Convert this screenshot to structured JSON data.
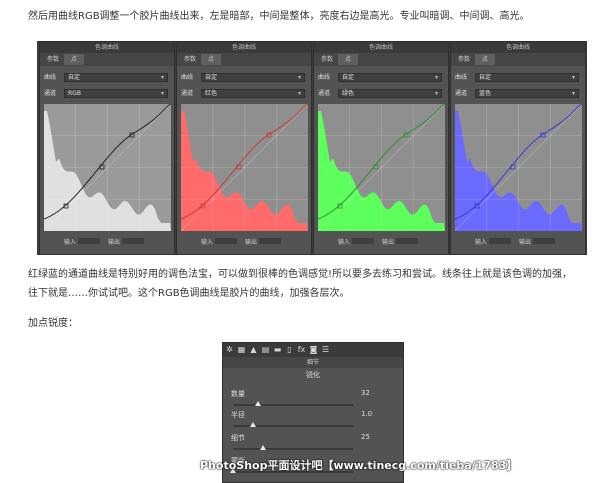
{
  "text": {
    "intro": "然后用曲线RGB调整一个胶片曲线出来，左是暗部，中间是整体，亮度右边是高光。专业叫暗调、中间调、高光。",
    "explain_line1": "红绿蓝的通道曲线是特别好用的调色法宝，可以做到很棒的色调感觉!所以要多去练习和尝试。线条往上就是该色调的加强，",
    "explain_line2": "往下就是……你试试吧。这个RGB色调曲线是胶片的曲线，加强各层次。",
    "sharpen_heading": "加点锐度："
  },
  "curves_panels": [
    {
      "title": "色调曲线",
      "tab_params": "参数",
      "tab_point": "点",
      "curve_label": "曲线",
      "curve_value": "自定",
      "channel_label": "通道",
      "channel_value": "RGB",
      "input_label": "输入",
      "output_label": "输出",
      "channel_color": "#222222",
      "hist_color": "#e0e0e0"
    },
    {
      "title": "色调曲线",
      "tab_params": "参数",
      "tab_point": "点",
      "curve_label": "曲线",
      "curve_value": "自定",
      "channel_label": "通道",
      "channel_value": "红色",
      "input_label": "输入",
      "output_label": "输出",
      "channel_color": "#c83a3a",
      "hist_color": "#ff6a6a"
    },
    {
      "title": "色调曲线",
      "tab_params": "参数",
      "tab_point": "点",
      "curve_label": "曲线",
      "curve_value": "自定",
      "channel_label": "通道",
      "channel_value": "绿色",
      "input_label": "输入",
      "output_label": "输出",
      "channel_color": "#2f8f2f",
      "hist_color": "#5cff5c"
    },
    {
      "title": "色调曲线",
      "tab_params": "参数",
      "tab_point": "点",
      "curve_label": "曲线",
      "curve_value": "自定",
      "channel_label": "通道",
      "channel_value": "蓝色",
      "input_label": "输入",
      "output_label": "输出",
      "channel_color": "#3a3ad0",
      "hist_color": "#6a6aff"
    }
  ],
  "detail": {
    "header": "细节",
    "section": "锐化",
    "sliders": [
      {
        "label": "数量",
        "value": "32",
        "level": 0.21
      },
      {
        "label": "半径",
        "value": "1.0",
        "level": 0.17
      },
      {
        "label": "细节",
        "value": "25",
        "level": 0.25
      },
      {
        "label": "蒙版",
        "value": "",
        "level": 0.0
      }
    ]
  },
  "watermark": "PhotoShop平面设计吧【www.tinecg.com/tieba/1783】"
}
